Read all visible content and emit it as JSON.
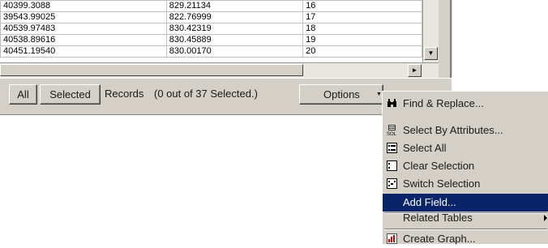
{
  "table": {
    "rows": [
      [
        "40399.3088",
        "829.21134",
        "16"
      ],
      [
        "39543.99025",
        "822.76999",
        "17"
      ],
      [
        "40539.97483",
        "830.42319",
        "18"
      ],
      [
        "40538.89616",
        "830.45889",
        "19"
      ],
      [
        "40451.19540",
        "830.00170",
        "20"
      ]
    ]
  },
  "footer": {
    "all_label": "All",
    "selected_label": "Selected",
    "records_label": "Records",
    "records_status": "(0 out of 37 Selected.)",
    "options_label": "Options"
  },
  "menu": {
    "items": [
      {
        "label": "Find & Replace...",
        "icon": "binoculars-icon"
      },
      {
        "label": "Select By Attributes...",
        "icon": "sql-icon"
      },
      {
        "label": "Select All",
        "icon": "select-all-icon"
      },
      {
        "label": "Clear Selection",
        "icon": "clear-selection-icon"
      },
      {
        "label": "Switch Selection",
        "icon": "switch-selection-icon"
      },
      {
        "label": "Add Field...",
        "highlighted": true
      },
      {
        "label": "Related Tables",
        "has_submenu": true
      },
      {
        "label": "Create Graph...",
        "icon": "graph-icon"
      }
    ]
  },
  "colors": {
    "highlight": "#0a246a",
    "face": "#d4d0c8"
  }
}
